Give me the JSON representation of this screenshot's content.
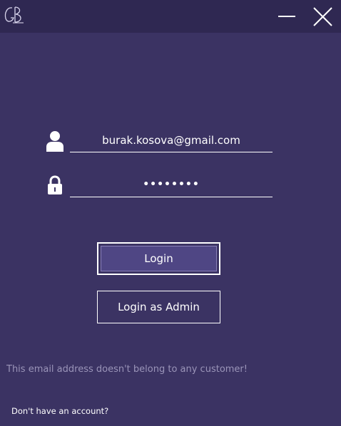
{
  "window": {
    "logo_text": "GB",
    "minimize_icon": "minimize-icon",
    "close_icon": "close-icon"
  },
  "form": {
    "email": {
      "icon": "user-icon",
      "value": "burak.kosova@gmail.com"
    },
    "password": {
      "icon": "lock-icon",
      "value": "••••••••"
    },
    "login_label": "Login",
    "admin_login_label": "Login as Admin"
  },
  "error_message": "This email address doesn't belong to any customer!",
  "signup_link": "Don't have an account?",
  "colors": {
    "background": "#3b3363",
    "titlebar": "#2f2852",
    "button_fill": "#4f4684",
    "error_text": "#9a94b8"
  }
}
